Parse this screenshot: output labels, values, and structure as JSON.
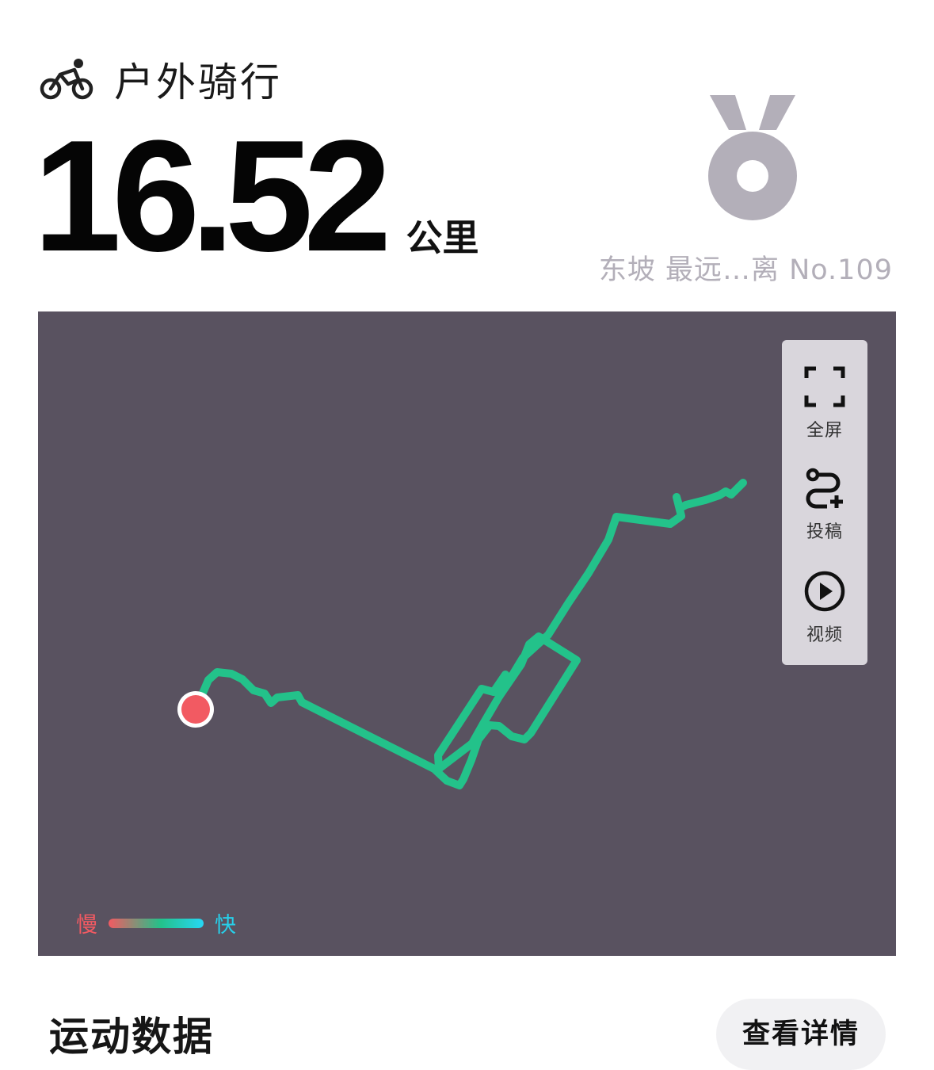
{
  "activity": {
    "type_label": "户外骑行",
    "icon": "cyclist-icon"
  },
  "distance": {
    "value": "16.52",
    "unit": "公里"
  },
  "medal": {
    "icon": "medal-icon",
    "caption": "东坡 最远…离 No.109",
    "color": "#b3afb9"
  },
  "map": {
    "background_color": "#595260",
    "route_color": "#23c28a",
    "start_marker_color": "#f25a62",
    "toolbar": [
      {
        "icon": "fullscreen-icon",
        "label": "全屏"
      },
      {
        "icon": "route-add-icon",
        "label": "投稿"
      },
      {
        "icon": "play-circle-icon",
        "label": "视频"
      }
    ],
    "legend": {
      "slow_label": "慢",
      "fast_label": "快",
      "slow_color": "#f25a62",
      "fast_color": "#27d7f5"
    }
  },
  "stats": {
    "section_title": "运动数据",
    "details_button_label": "查看详情"
  }
}
